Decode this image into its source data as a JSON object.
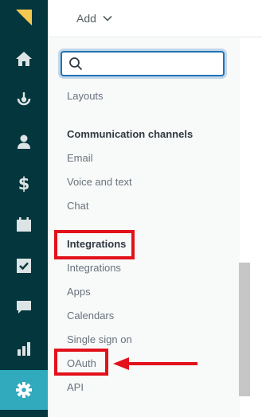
{
  "header": {
    "add_label": "Add"
  },
  "search": {
    "placeholder": "",
    "value": ""
  },
  "sidebar_rail": {
    "icons": [
      "logo-icon",
      "home-icon",
      "views-icon",
      "customers-icon",
      "billing-icon",
      "calendar-icon",
      "tasks-icon",
      "chat-icon",
      "reports-icon",
      "settings-icon"
    ],
    "active": "settings-icon",
    "active_color": "#30aabc",
    "bg_color": "#03363d"
  },
  "panel": {
    "top_item": "Layouts",
    "communication_channels": {
      "title": "Communication channels",
      "items": [
        "Email",
        "Voice and text",
        "Chat"
      ]
    },
    "integrations": {
      "title": "Integrations",
      "items": [
        "Integrations",
        "Apps",
        "Calendars",
        "Single sign on",
        "OAuth",
        "API"
      ]
    }
  },
  "annotation": {
    "color": "#e2111a",
    "highlighted": [
      "Integrations",
      "OAuth"
    ]
  }
}
